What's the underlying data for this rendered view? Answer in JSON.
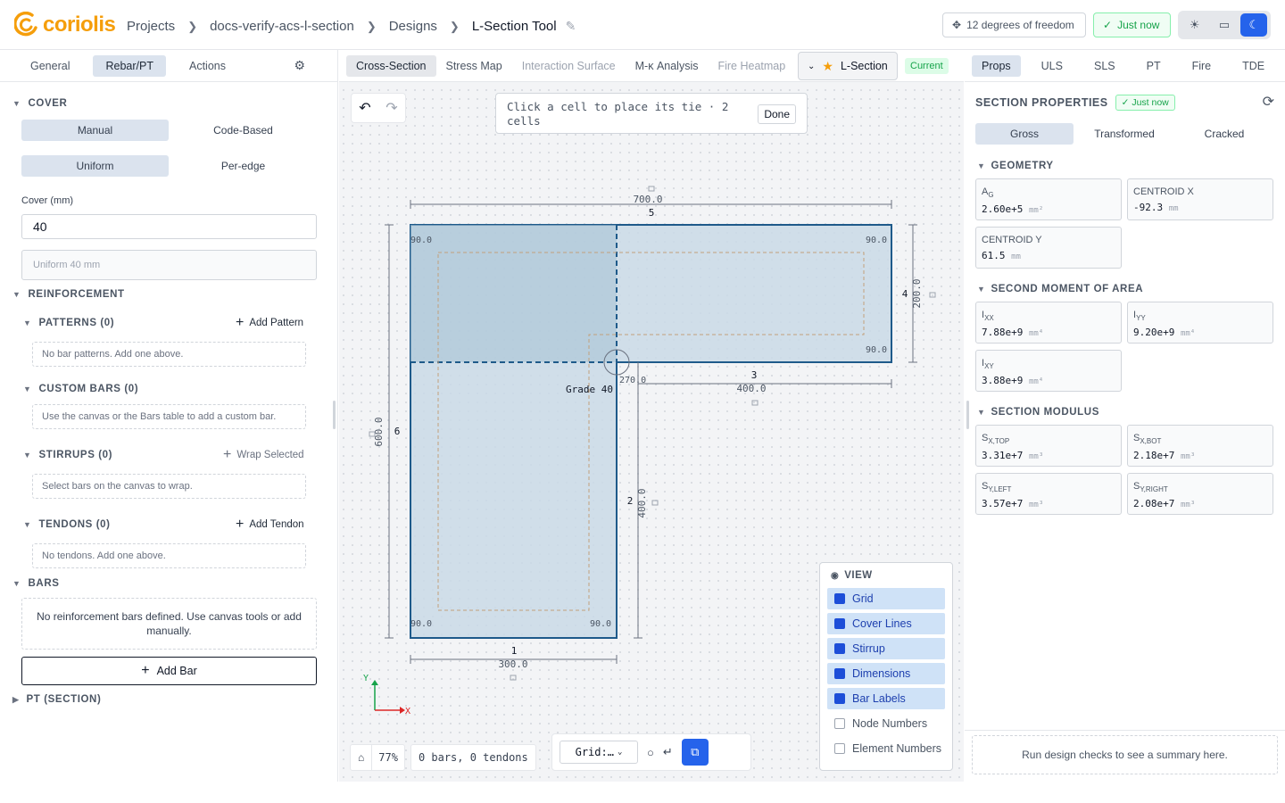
{
  "app": {
    "brand": "coriolis"
  },
  "breadcrumb": {
    "projects": "Projects",
    "project": "docs-verify-acs-l-section",
    "designs": "Designs",
    "current": "L-Section Tool"
  },
  "header": {
    "dof": "12 degrees of freedom",
    "saved": "Just now"
  },
  "left": {
    "tabs": [
      "General",
      "Rebar/PT",
      "Actions"
    ],
    "cover": {
      "title": "COVER",
      "mode": [
        "Manual",
        "Code-Based"
      ],
      "dist": [
        "Uniform",
        "Per-edge"
      ],
      "label": "Cover (mm)",
      "value": "40",
      "summary": "Uniform 40 mm"
    },
    "reinforcement": {
      "title": "REINFORCEMENT",
      "patterns": {
        "title": "PATTERNS (0)",
        "action": "Add Pattern",
        "empty": "No bar patterns. Add one above."
      },
      "custom": {
        "title": "CUSTOM BARS (0)",
        "empty": "Use the canvas or the Bars table to add a custom bar."
      },
      "stirrups": {
        "title": "STIRRUPS (0)",
        "action": "Wrap Selected",
        "empty": "Select bars on the canvas to wrap."
      },
      "tendons": {
        "title": "TENDONS (0)",
        "action": "Add Tendon",
        "empty": "No tendons. Add one above."
      }
    },
    "bars": {
      "title": "BARS",
      "empty": "No reinforcement bars defined. Use canvas tools or add manually.",
      "add": "Add Bar"
    },
    "pt": {
      "title": "PT (SECTION)"
    }
  },
  "center": {
    "tabs": [
      "Cross-Section",
      "Stress Map",
      "Interaction Surface",
      "M-κ Analysis",
      "Fire Heatmap"
    ],
    "design_name": "L-Section",
    "current_badge": "Current",
    "hint": "Click a cell to place its tie · 2 cells",
    "done": "Done",
    "drawing": {
      "dims": {
        "top": "700.0",
        "right": "200.0",
        "step": "400.0",
        "stem_right": "400.0",
        "bottom": "300.0",
        "left": "600.0"
      },
      "edges": [
        "1",
        "2",
        "3",
        "4",
        "5",
        "6"
      ],
      "corners": [
        "90.0",
        "90.0",
        "90.0",
        "90.0",
        "90.0",
        "270.0"
      ],
      "material": "Grade 40",
      "axis_x": "X",
      "axis_y": "Y"
    },
    "view": {
      "title": "VIEW",
      "options": [
        {
          "label": "Grid",
          "on": true
        },
        {
          "label": "Cover Lines",
          "on": true
        },
        {
          "label": "Stirrup",
          "on": true
        },
        {
          "label": "Dimensions",
          "on": true
        },
        {
          "label": "Bar Labels",
          "on": true
        },
        {
          "label": "Node Numbers",
          "on": false
        },
        {
          "label": "Element Numbers",
          "on": false
        }
      ]
    },
    "zoom": "77%",
    "counts": "0 bars, 0 tendons",
    "grid_select": "Grid:…"
  },
  "right": {
    "tabs": [
      "Props",
      "ULS",
      "SLS",
      "PT",
      "Fire",
      "TDE"
    ],
    "title": "SECTION PROPERTIES",
    "badge": "Just now",
    "modes": [
      "Gross",
      "Transformed",
      "Cracked"
    ],
    "geometry": {
      "title": "GEOMETRY",
      "ag": {
        "label": "A",
        "sub": "G",
        "value": "2.60e+5",
        "unit": "mm²"
      },
      "cx": {
        "label": "CENTROID X",
        "value": "-92.3",
        "unit": "mm"
      },
      "cy": {
        "label": "CENTROID Y",
        "value": "61.5",
        "unit": "mm"
      }
    },
    "moment": {
      "title": "SECOND MOMENT OF AREA",
      "ixx": {
        "label": "I",
        "sub": "XX",
        "value": "7.88e+9",
        "unit": "mm⁴"
      },
      "iyy": {
        "label": "I",
        "sub": "YY",
        "value": "9.20e+9",
        "unit": "mm⁴"
      },
      "ixy": {
        "label": "I",
        "sub": "XY",
        "value": "3.88e+9",
        "unit": "mm⁴"
      }
    },
    "modulus": {
      "title": "SECTION MODULUS",
      "sxt": {
        "label": "S",
        "sub": "X,TOP",
        "value": "3.31e+7",
        "unit": "mm³"
      },
      "sxb": {
        "label": "S",
        "sub": "X,BOT",
        "value": "2.18e+7",
        "unit": "mm³"
      },
      "syl": {
        "label": "S",
        "sub": "Y,LEFT",
        "value": "3.57e+7",
        "unit": "mm³"
      },
      "syr": {
        "label": "S",
        "sub": "Y,RIGHT",
        "value": "2.08e+7",
        "unit": "mm³"
      }
    },
    "summary": "Run design checks to see a summary here."
  },
  "colors": {
    "accent": "#2563eb",
    "brand": "#f59e0b",
    "success": "#16a34a",
    "section_fill": "#c9d9e6",
    "section_edge": "#1e5a8a"
  }
}
